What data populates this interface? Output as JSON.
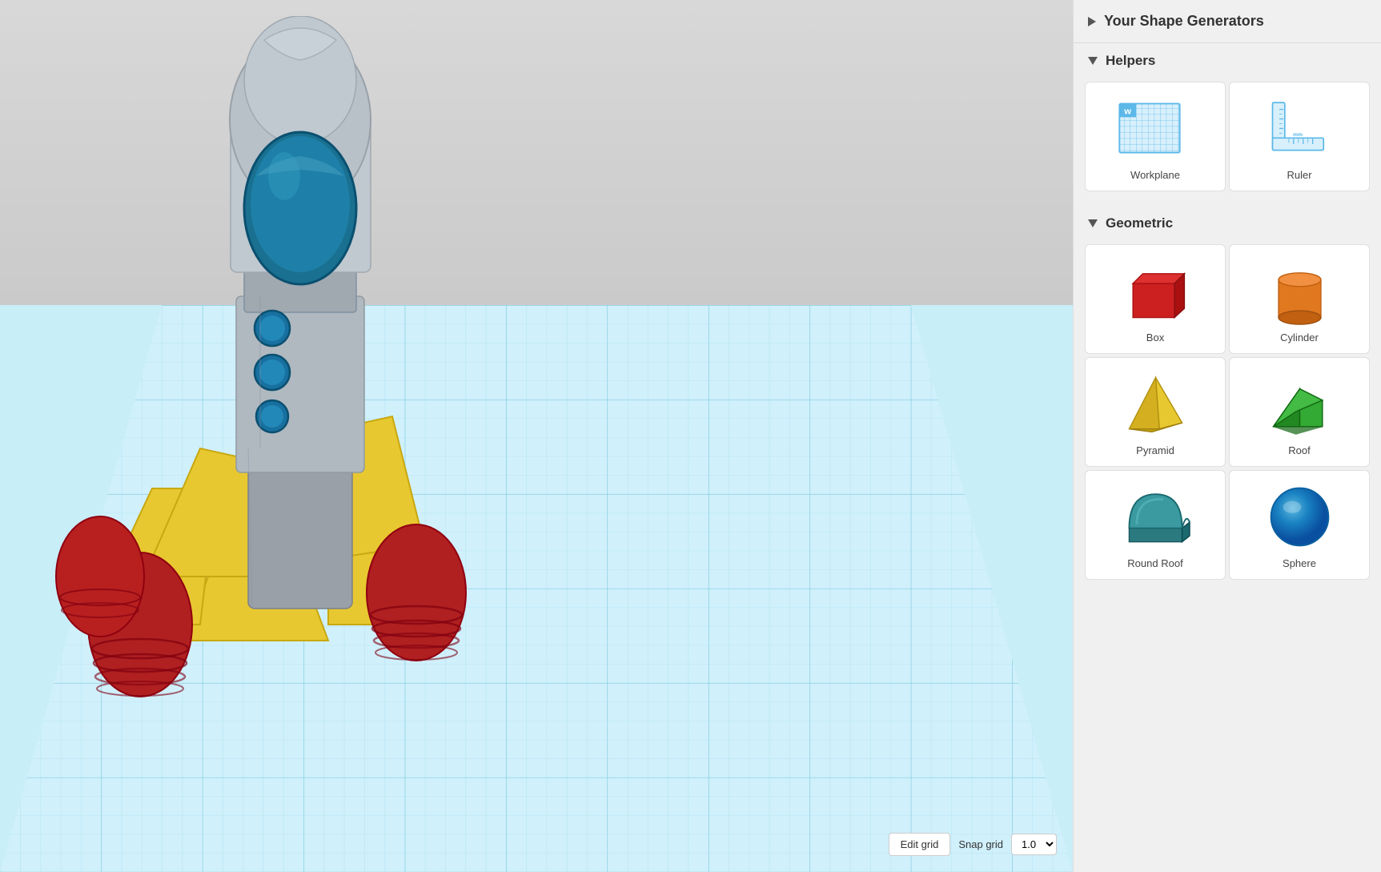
{
  "viewport": {
    "snap_grid_label": "Snap grid",
    "snap_grid_value": "1.0",
    "edit_grid_label": "Edit grid"
  },
  "panel": {
    "shape_generators_title": "Your Shape Generators",
    "helpers_title": "Helpers",
    "geometric_title": "Geometric",
    "helpers": [
      {
        "id": "workplane",
        "label": "Workplane"
      },
      {
        "id": "ruler",
        "label": "Ruler"
      }
    ],
    "geometric": [
      {
        "id": "box",
        "label": "Box"
      },
      {
        "id": "cylinder",
        "label": "Cylinder"
      },
      {
        "id": "pyramid",
        "label": "Pyramid"
      },
      {
        "id": "roof",
        "label": "Roof"
      },
      {
        "id": "round-roof",
        "label": "Round Roof"
      },
      {
        "id": "sphere",
        "label": "Sphere"
      }
    ]
  }
}
